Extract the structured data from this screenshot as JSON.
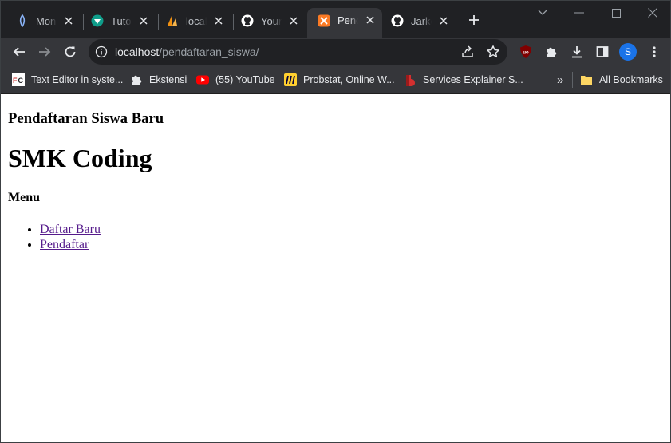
{
  "tabs": [
    {
      "title": "MongoDB",
      "icon": "mongodb-leaf-icon",
      "active": false
    },
    {
      "title": "Tutorial",
      "icon": "tutorial-logo-icon",
      "active": false
    },
    {
      "title": "localhost",
      "icon": "phpmyadmin-sail-icon",
      "active": false
    },
    {
      "title": "Your Repositories",
      "icon": "github-icon",
      "active": false
    },
    {
      "title": "Pendaftaran Siswa Baru",
      "icon": "xampp-icon",
      "active": true
    },
    {
      "title": "Jarkom",
      "icon": "github-icon",
      "active": false
    }
  ],
  "address": {
    "host": "localhost",
    "path": "/pendaftaran_siswa/"
  },
  "profile_initial": "S",
  "bookmarks": [
    {
      "label": "Text Editor in syste...",
      "icon": "fc-icon"
    },
    {
      "label": "Ekstensi",
      "icon": "puzzle-icon"
    },
    {
      "label": "(55) YouTube",
      "icon": "youtube-icon"
    },
    {
      "label": "Probstat, Online W...",
      "icon": "miro-icon"
    },
    {
      "label": "Services Explainer S...",
      "icon": "explainer-icon"
    }
  ],
  "overflow_label": "»",
  "all_bookmarks_label": "All Bookmarks",
  "colors": {
    "tabstrip_bg": "#202124",
    "toolbar_bg": "#35363a",
    "link_visited": "#551a8b",
    "avatar": "#1a73e8"
  },
  "page": {
    "subtitle": "Pendaftaran Siswa Baru",
    "title": "SMK Coding",
    "menu_heading": "Menu",
    "menu_items": [
      "Daftar Baru",
      "Pendaftar"
    ]
  }
}
